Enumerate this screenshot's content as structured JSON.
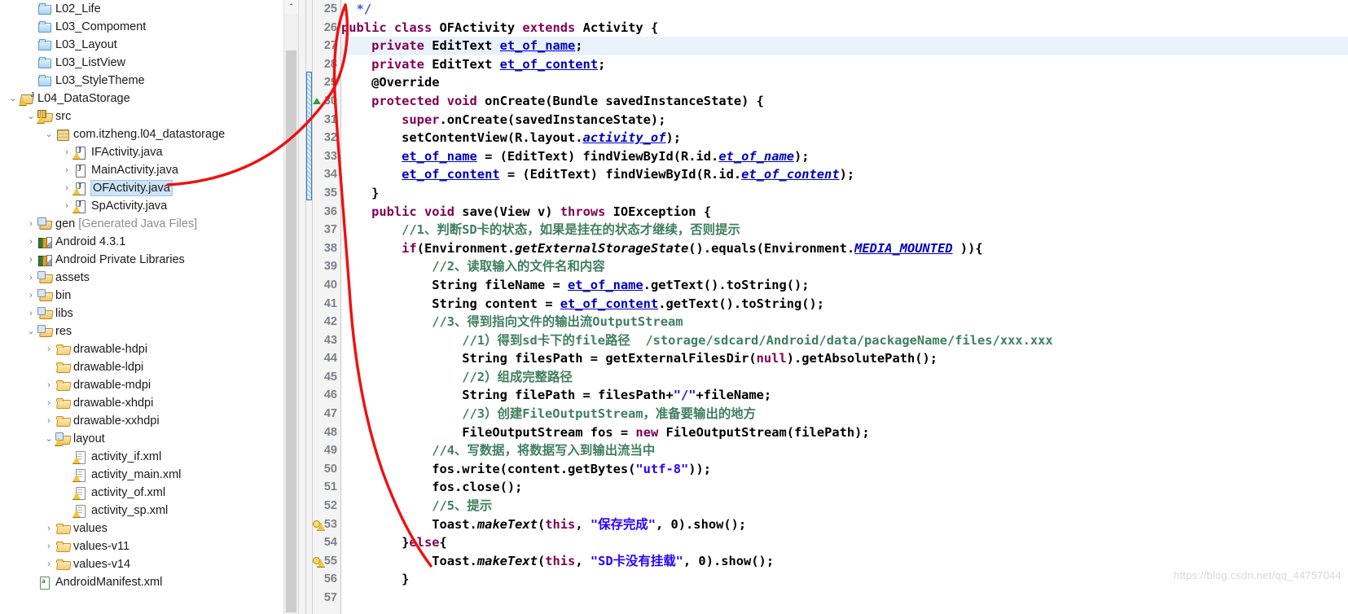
{
  "explorer": {
    "name": "package-explorer",
    "scrollbar": {
      "up_arrow": "⌃"
    },
    "items": [
      {
        "label": "L02_Life",
        "indent": 1,
        "twisty": "",
        "icon": "folder-blue",
        "selected": false
      },
      {
        "label": "L03_Compoment",
        "indent": 1,
        "twisty": "",
        "icon": "folder-blue",
        "selected": false
      },
      {
        "label": "L03_Layout",
        "indent": 1,
        "twisty": "",
        "icon": "folder-blue",
        "selected": false
      },
      {
        "label": "L03_ListView",
        "indent": 1,
        "twisty": "",
        "icon": "folder-blue",
        "selected": false
      },
      {
        "label": "L03_StyleTheme",
        "indent": 1,
        "twisty": "",
        "icon": "folder-blue",
        "selected": false
      },
      {
        "label": "L04_DataStorage",
        "indent": 0,
        "twisty": "⌄",
        "icon": "project-java",
        "selected": false
      },
      {
        "label": "src",
        "indent": 1,
        "twisty": "⌄",
        "icon": "source-folder",
        "selected": false
      },
      {
        "label": "com.itzheng.l04_datastorage",
        "indent": 2,
        "twisty": "⌄",
        "icon": "package",
        "selected": false
      },
      {
        "label": "IFActivity.java",
        "indent": 3,
        "twisty": "›",
        "icon": "java-file-warn",
        "selected": false
      },
      {
        "label": "MainActivity.java",
        "indent": 3,
        "twisty": "›",
        "icon": "java-file",
        "selected": false
      },
      {
        "label": "OFActivity.java",
        "indent": 3,
        "twisty": "›",
        "icon": "java-file-warn",
        "selected": true
      },
      {
        "label": "SpActivity.java",
        "indent": 3,
        "twisty": "›",
        "icon": "java-file-warn",
        "selected": false
      },
      {
        "label": "gen",
        "sublabel": " [Generated Java Files]",
        "indent": 1,
        "twisty": "›",
        "icon": "gen-folder",
        "selected": false
      },
      {
        "label": "Android 4.3.1",
        "indent": 1,
        "twisty": "›",
        "icon": "library",
        "selected": false
      },
      {
        "label": "Android Private Libraries",
        "indent": 1,
        "twisty": "›",
        "icon": "library",
        "selected": false
      },
      {
        "label": "assets",
        "indent": 1,
        "twisty": "›",
        "icon": "res-folder",
        "selected": false
      },
      {
        "label": "bin",
        "indent": 1,
        "twisty": "›",
        "icon": "res-folder",
        "selected": false
      },
      {
        "label": "libs",
        "indent": 1,
        "twisty": "›",
        "icon": "res-folder",
        "selected": false
      },
      {
        "label": "res",
        "indent": 1,
        "twisty": "⌄",
        "icon": "res-folder",
        "selected": false
      },
      {
        "label": "drawable-hdpi",
        "indent": 2,
        "twisty": "›",
        "icon": "folder-yellow",
        "selected": false
      },
      {
        "label": "drawable-ldpi",
        "indent": 2,
        "twisty": "",
        "icon": "folder-yellow",
        "selected": false
      },
      {
        "label": "drawable-mdpi",
        "indent": 2,
        "twisty": "›",
        "icon": "folder-yellow",
        "selected": false
      },
      {
        "label": "drawable-xhdpi",
        "indent": 2,
        "twisty": "›",
        "icon": "folder-yellow",
        "selected": false
      },
      {
        "label": "drawable-xxhdpi",
        "indent": 2,
        "twisty": "›",
        "icon": "folder-yellow",
        "selected": false
      },
      {
        "label": "layout",
        "indent": 2,
        "twisty": "⌄",
        "icon": "folder-res-warn",
        "selected": false
      },
      {
        "label": "activity_if.xml",
        "indent": 3,
        "twisty": "",
        "icon": "xml-file-warn",
        "selected": false
      },
      {
        "label": "activity_main.xml",
        "indent": 3,
        "twisty": "",
        "icon": "xml-file-warn",
        "selected": false
      },
      {
        "label": "activity_of.xml",
        "indent": 3,
        "twisty": "",
        "icon": "xml-file-warn",
        "selected": false
      },
      {
        "label": "activity_sp.xml",
        "indent": 3,
        "twisty": "",
        "icon": "xml-file-warn",
        "selected": false
      },
      {
        "label": "values",
        "indent": 2,
        "twisty": "›",
        "icon": "folder-yellow",
        "selected": false
      },
      {
        "label": "values-v11",
        "indent": 2,
        "twisty": "›",
        "icon": "folder-yellow",
        "selected": false
      },
      {
        "label": "values-v14",
        "indent": 2,
        "twisty": "›",
        "icon": "folder-yellow",
        "selected": false
      },
      {
        "label": "AndroidManifest.xml",
        "indent": 1,
        "twisty": "",
        "icon": "xml-manifest",
        "selected": false
      }
    ]
  },
  "editor": {
    "name": "java-code-editor",
    "file": "OFActivity.java",
    "first_line_number": 25,
    "current_line": 27,
    "lines": [
      {
        "n": 25,
        "mark": "",
        "fold": false,
        "current": false,
        "tokens": [
          {
            "t": "  ",
            "c": "plain"
          },
          {
            "t": "*/",
            "c": "jdoc"
          }
        ]
      },
      {
        "n": 26,
        "mark": "",
        "fold": false,
        "current": false,
        "tokens": [
          {
            "t": "public ",
            "c": "kw"
          },
          {
            "t": "class ",
            "c": "kw"
          },
          {
            "t": "OFActivity ",
            "c": "plain"
          },
          {
            "t": "extends ",
            "c": "kw"
          },
          {
            "t": "Activity {",
            "c": "plain"
          }
        ]
      },
      {
        "n": 27,
        "mark": "",
        "fold": false,
        "current": true,
        "tokens": [
          {
            "t": "    ",
            "c": "plain"
          },
          {
            "t": "private ",
            "c": "kw"
          },
          {
            "t": "EditText ",
            "c": "plain"
          },
          {
            "t": "et_of_name",
            "c": "blu"
          },
          {
            "t": ";",
            "c": "plain"
          }
        ]
      },
      {
        "n": 28,
        "mark": "",
        "fold": false,
        "current": false,
        "tokens": [
          {
            "t": "    ",
            "c": "plain"
          },
          {
            "t": "private ",
            "c": "kw"
          },
          {
            "t": "EditText ",
            "c": "plain"
          },
          {
            "t": "et_of_content",
            "c": "blu"
          },
          {
            "t": ";",
            "c": "plain"
          }
        ]
      },
      {
        "n": 29,
        "mark": "",
        "fold": true,
        "current": false,
        "tokens": [
          {
            "t": "    ",
            "c": "plain"
          },
          {
            "t": "@Override",
            "c": "plain"
          }
        ]
      },
      {
        "n": 30,
        "mark": "arrow",
        "fold": false,
        "current": false,
        "tokens": [
          {
            "t": "    ",
            "c": "plain"
          },
          {
            "t": "protected ",
            "c": "kw"
          },
          {
            "t": "void ",
            "c": "kw"
          },
          {
            "t": "onCreate(Bundle savedInstanceState) {",
            "c": "plain"
          }
        ]
      },
      {
        "n": 31,
        "mark": "",
        "fold": false,
        "current": false,
        "tokens": [
          {
            "t": "        ",
            "c": "plain"
          },
          {
            "t": "super",
            "c": "kw"
          },
          {
            "t": ".onCreate(savedInstanceState);",
            "c": "plain"
          }
        ]
      },
      {
        "n": 32,
        "mark": "",
        "fold": false,
        "current": false,
        "tokens": [
          {
            "t": "        ",
            "c": "plain"
          },
          {
            "t": "setContentView(R.layout.",
            "c": "plain"
          },
          {
            "t": "activity_of",
            "c": "sfld"
          },
          {
            "t": ");",
            "c": "plain"
          }
        ]
      },
      {
        "n": 33,
        "mark": "",
        "fold": false,
        "current": false,
        "tokens": [
          {
            "t": "        ",
            "c": "plain"
          },
          {
            "t": "et_of_name",
            "c": "blu"
          },
          {
            "t": " = (EditText) findViewById(R.id.",
            "c": "plain"
          },
          {
            "t": "et_of_name",
            "c": "sfld"
          },
          {
            "t": ");",
            "c": "plain"
          }
        ]
      },
      {
        "n": 34,
        "mark": "",
        "fold": false,
        "current": false,
        "tokens": [
          {
            "t": "        ",
            "c": "plain"
          },
          {
            "t": "et_of_content",
            "c": "blu"
          },
          {
            "t": " = (EditText) findViewById(R.id.",
            "c": "plain"
          },
          {
            "t": "et_of_content",
            "c": "sfld"
          },
          {
            "t": ");",
            "c": "plain"
          }
        ]
      },
      {
        "n": 35,
        "mark": "",
        "fold": false,
        "current": false,
        "tokens": [
          {
            "t": "    }",
            "c": "plain"
          }
        ]
      },
      {
        "n": 36,
        "mark": "",
        "fold": true,
        "current": false,
        "tokens": [
          {
            "t": "    ",
            "c": "plain"
          },
          {
            "t": "public ",
            "c": "kw"
          },
          {
            "t": "void ",
            "c": "kw"
          },
          {
            "t": "save(View v) ",
            "c": "plain"
          },
          {
            "t": "throws ",
            "c": "kw"
          },
          {
            "t": "IOException {",
            "c": "plain"
          }
        ]
      },
      {
        "n": 37,
        "mark": "",
        "fold": false,
        "current": false,
        "tokens": [
          {
            "t": "        ",
            "c": "plain"
          },
          {
            "t": "//1、判断SD卡的状态，如果是挂在的状态才继续，否则提示",
            "c": "cmt"
          }
        ]
      },
      {
        "n": 38,
        "mark": "",
        "fold": false,
        "current": false,
        "tokens": [
          {
            "t": "        ",
            "c": "plain"
          },
          {
            "t": "if",
            "c": "kw"
          },
          {
            "t": "(Environment.",
            "c": "plain"
          },
          {
            "t": "getExternalStorageState",
            "c": "mth"
          },
          {
            "t": "().equals(Environment.",
            "c": "plain"
          },
          {
            "t": "MEDIA_MOUNTED",
            "c": "sfld"
          },
          {
            "t": " )){",
            "c": "plain"
          }
        ]
      },
      {
        "n": 39,
        "mark": "",
        "fold": false,
        "current": false,
        "tokens": [
          {
            "t": "            ",
            "c": "plain"
          },
          {
            "t": "//2、读取输入的文件名和内容",
            "c": "cmt"
          }
        ]
      },
      {
        "n": 40,
        "mark": "",
        "fold": false,
        "current": false,
        "tokens": [
          {
            "t": "            ",
            "c": "plain"
          },
          {
            "t": "String fileName = ",
            "c": "plain"
          },
          {
            "t": "et_of_name",
            "c": "blu"
          },
          {
            "t": ".getText().toString();",
            "c": "plain"
          }
        ]
      },
      {
        "n": 41,
        "mark": "",
        "fold": false,
        "current": false,
        "tokens": [
          {
            "t": "            ",
            "c": "plain"
          },
          {
            "t": "String content = ",
            "c": "plain"
          },
          {
            "t": "et_of_content",
            "c": "blu"
          },
          {
            "t": ".getText().toString();",
            "c": "plain"
          }
        ]
      },
      {
        "n": 42,
        "mark": "",
        "fold": false,
        "current": false,
        "tokens": [
          {
            "t": "            ",
            "c": "plain"
          },
          {
            "t": "//3、得到指向文件的输出流OutputStream",
            "c": "cmt"
          }
        ]
      },
      {
        "n": 43,
        "mark": "",
        "fold": false,
        "current": false,
        "tokens": [
          {
            "t": "                ",
            "c": "plain"
          },
          {
            "t": "//1）得到sd卡下的file路径  /storage/sdcard/Android/data/packageName/files/xxx.xxx",
            "c": "cmt"
          }
        ]
      },
      {
        "n": 44,
        "mark": "",
        "fold": false,
        "current": false,
        "tokens": [
          {
            "t": "                ",
            "c": "plain"
          },
          {
            "t": "String filesPath = getExternalFilesDir(",
            "c": "plain"
          },
          {
            "t": "null",
            "c": "kw"
          },
          {
            "t": ").getAbsolutePath();",
            "c": "plain"
          }
        ]
      },
      {
        "n": 45,
        "mark": "",
        "fold": false,
        "current": false,
        "tokens": [
          {
            "t": "                ",
            "c": "plain"
          },
          {
            "t": "//2）组成完整路径",
            "c": "cmt"
          }
        ]
      },
      {
        "n": 46,
        "mark": "",
        "fold": false,
        "current": false,
        "tokens": [
          {
            "t": "                ",
            "c": "plain"
          },
          {
            "t": "String filePath = filesPath+",
            "c": "plain"
          },
          {
            "t": "\"/\"",
            "c": "str"
          },
          {
            "t": "+fileName;",
            "c": "plain"
          }
        ]
      },
      {
        "n": 47,
        "mark": "",
        "fold": false,
        "current": false,
        "tokens": [
          {
            "t": "                ",
            "c": "plain"
          },
          {
            "t": "//3）创建FileOutputStream，准备要输出的地方",
            "c": "cmt"
          }
        ]
      },
      {
        "n": 48,
        "mark": "",
        "fold": false,
        "current": false,
        "tokens": [
          {
            "t": "                ",
            "c": "plain"
          },
          {
            "t": "FileOutputStream ",
            "c": "plain"
          },
          {
            "t": "fos",
            "c": "plain"
          },
          {
            "t": " = ",
            "c": "plain"
          },
          {
            "t": "new ",
            "c": "kw"
          },
          {
            "t": "FileOutputStream(filePath);",
            "c": "plain"
          }
        ]
      },
      {
        "n": 49,
        "mark": "",
        "fold": false,
        "current": false,
        "tokens": [
          {
            "t": "            ",
            "c": "plain"
          },
          {
            "t": "//4、写数据，将数据写入到输出流当中",
            "c": "cmt"
          }
        ]
      },
      {
        "n": 50,
        "mark": "",
        "fold": false,
        "current": false,
        "tokens": [
          {
            "t": "            ",
            "c": "plain"
          },
          {
            "t": "fos.write(content.getBytes(",
            "c": "plain"
          },
          {
            "t": "\"utf-8\"",
            "c": "str"
          },
          {
            "t": "));",
            "c": "plain"
          }
        ]
      },
      {
        "n": 51,
        "mark": "",
        "fold": false,
        "current": false,
        "tokens": [
          {
            "t": "            ",
            "c": "plain"
          },
          {
            "t": "fos.close();",
            "c": "plain"
          }
        ]
      },
      {
        "n": 52,
        "mark": "",
        "fold": false,
        "current": false,
        "tokens": [
          {
            "t": "            ",
            "c": "plain"
          },
          {
            "t": "//5、提示",
            "c": "cmt"
          }
        ]
      },
      {
        "n": 53,
        "mark": "warn",
        "fold": false,
        "current": false,
        "tokens": [
          {
            "t": "            ",
            "c": "plain"
          },
          {
            "t": "Toast.",
            "c": "plain"
          },
          {
            "t": "makeText",
            "c": "mth"
          },
          {
            "t": "(",
            "c": "plain"
          },
          {
            "t": "this",
            "c": "kw"
          },
          {
            "t": ", ",
            "c": "plain"
          },
          {
            "t": "\"保存完成\"",
            "c": "str"
          },
          {
            "t": ", 0).show();",
            "c": "plain"
          }
        ]
      },
      {
        "n": 54,
        "mark": "",
        "fold": false,
        "current": false,
        "tokens": [
          {
            "t": "        }",
            "c": "plain"
          },
          {
            "t": "else",
            "c": "kw"
          },
          {
            "t": "{",
            "c": "plain"
          }
        ]
      },
      {
        "n": 55,
        "mark": "warn",
        "fold": false,
        "current": false,
        "tokens": [
          {
            "t": "            ",
            "c": "plain"
          },
          {
            "t": "Toast.",
            "c": "plain"
          },
          {
            "t": "makeText",
            "c": "mth"
          },
          {
            "t": "(",
            "c": "plain"
          },
          {
            "t": "this",
            "c": "kw"
          },
          {
            "t": ", ",
            "c": "plain"
          },
          {
            "t": "\"SD卡没有挂载\"",
            "c": "str"
          },
          {
            "t": ", 0).show();",
            "c": "plain"
          }
        ]
      },
      {
        "n": 56,
        "mark": "",
        "fold": false,
        "current": false,
        "tokens": [
          {
            "t": "        }",
            "c": "plain"
          }
        ]
      },
      {
        "n": 57,
        "mark": "",
        "fold": false,
        "current": false,
        "tokens": [
          {
            "t": "",
            "c": "plain"
          }
        ]
      }
    ]
  },
  "annotation": {
    "name": "red-arrow-annotation",
    "color": "#ee1111",
    "description": "hand-drawn red curve from OFActivity.java in tree to closing brace on line 56"
  },
  "watermark": {
    "text": "https://blog.csdn.net/qq_44757044"
  },
  "colors": {
    "selection_blue": "#cde4f7",
    "current_line": "#eaf2fb",
    "keyword_purple": "#7f0055",
    "string_blue": "#2a00ff",
    "comment_green": "#3f7f5f",
    "field_blue": "#0000c0",
    "gutter_grey": "#f4f4f4",
    "annotation_red": "#ee1111"
  }
}
